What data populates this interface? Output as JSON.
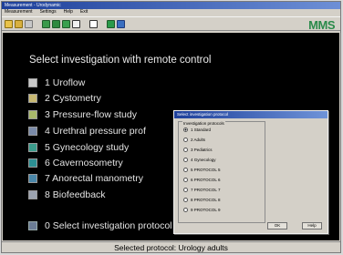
{
  "window": {
    "title": "Measurement - Urodynamic"
  },
  "menubar": {
    "items": [
      "Measurement",
      "Settings",
      "Help",
      "Exit"
    ]
  },
  "toolbar": {
    "logo": "MMS",
    "icons": [
      "open-icon",
      "save-icon",
      "print-icon",
      "patient-icon",
      "settings-icon",
      "chart-icon",
      "window-icon",
      "report-icon"
    ]
  },
  "main": {
    "heading": "Select investigation with remote control",
    "investigations": [
      {
        "label": "1 Uroflow",
        "icon": "uroflow-icon",
        "color": "#c9c9c9"
      },
      {
        "label": "2 Cystometry",
        "icon": "cystometry-icon",
        "color": "#c7b872"
      },
      {
        "label": "3 Pressure-flow study",
        "icon": "pressure-flow-icon",
        "color": "#a8b86a"
      },
      {
        "label": "4 Urethral pressure prof",
        "icon": "urethral-pressure-icon",
        "color": "#7a8aa8"
      },
      {
        "label": "5 Gynecology study",
        "icon": "gynecology-icon",
        "color": "#3b9c8c"
      },
      {
        "label": "6 Cavernosometry",
        "icon": "cavernosometry-icon",
        "color": "#2c8f93"
      },
      {
        "label": "7 Anorectal manometry",
        "icon": "anorectal-icon",
        "color": "#4a87a9"
      },
      {
        "label": "8 Biofeedback",
        "icon": "biofeedback-icon",
        "color": "#9ca3b0"
      }
    ],
    "select_protocol": "0 Select investigation protocol"
  },
  "dialog": {
    "title": "Select investigation protocol",
    "group_label": "Investigation protocols",
    "options": [
      {
        "label": "1 Standard",
        "selected": true
      },
      {
        "label": "2 Adults",
        "selected": false
      },
      {
        "label": "3 Pediatrics",
        "selected": false
      },
      {
        "label": "4 Gynecology",
        "selected": false
      },
      {
        "label": "5 PROTOCOL 5",
        "selected": false
      },
      {
        "label": "6 PROTOCOL 6",
        "selected": false
      },
      {
        "label": "7 PROTOCOL 7",
        "selected": false
      },
      {
        "label": "8 PROTOCOL 8",
        "selected": false
      },
      {
        "label": "9 PROTOCOL 9",
        "selected": false
      }
    ],
    "ok_label": "OK",
    "help_label": "Help"
  },
  "statusbar": {
    "text": "Selected protocol: Urology adults"
  }
}
